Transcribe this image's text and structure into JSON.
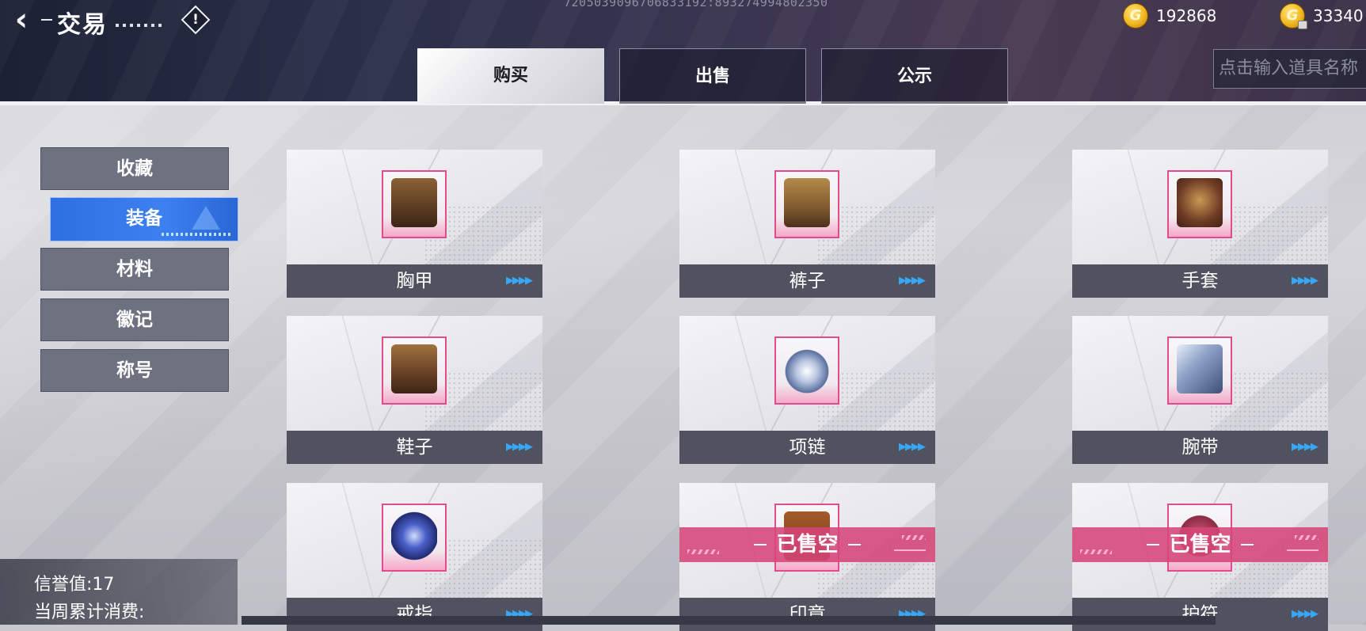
{
  "header": {
    "title": "交易",
    "server_id": "7205039096706833192:893274994802350",
    "currency": [
      {
        "icon": "gold-coin-icon",
        "value": "192868"
      },
      {
        "icon": "bound-gold-coin-icon",
        "value": "33340"
      }
    ],
    "tabs": [
      {
        "label": "购买",
        "active": true
      },
      {
        "label": "出售",
        "active": false
      },
      {
        "label": "公示",
        "active": false
      }
    ],
    "search_placeholder": "点击输入道具名称"
  },
  "sidebar": {
    "items": [
      {
        "label": "收藏",
        "active": false
      },
      {
        "label": "装备",
        "active": true
      },
      {
        "label": "材料",
        "active": false
      },
      {
        "label": "徽记",
        "active": false
      },
      {
        "label": "称号",
        "active": false
      }
    ]
  },
  "items": [
    {
      "label": "胸甲",
      "icon": "chest-armor-icon",
      "sold_out": false
    },
    {
      "label": "裤子",
      "icon": "pants-icon",
      "sold_out": false
    },
    {
      "label": "手套",
      "icon": "gloves-icon",
      "sold_out": false
    },
    {
      "label": "鞋子",
      "icon": "boots-icon",
      "sold_out": false
    },
    {
      "label": "项链",
      "icon": "necklace-icon",
      "sold_out": false
    },
    {
      "label": "腕带",
      "icon": "wristband-icon",
      "sold_out": false
    },
    {
      "label": "戒指",
      "icon": "ring-icon",
      "sold_out": false
    },
    {
      "label": "印章",
      "icon": "seal-icon",
      "sold_out": true
    },
    {
      "label": "护符",
      "icon": "amulet-icon",
      "sold_out": true
    }
  ],
  "sold_out_label": "已售空",
  "footer": {
    "reputation": "信誉值:17",
    "weekly_spend": "当周累计消费:"
  },
  "colors": {
    "accent_blue": "#3d80f0",
    "sold_out_pink": "#d64678",
    "gold": "#f2b720"
  }
}
